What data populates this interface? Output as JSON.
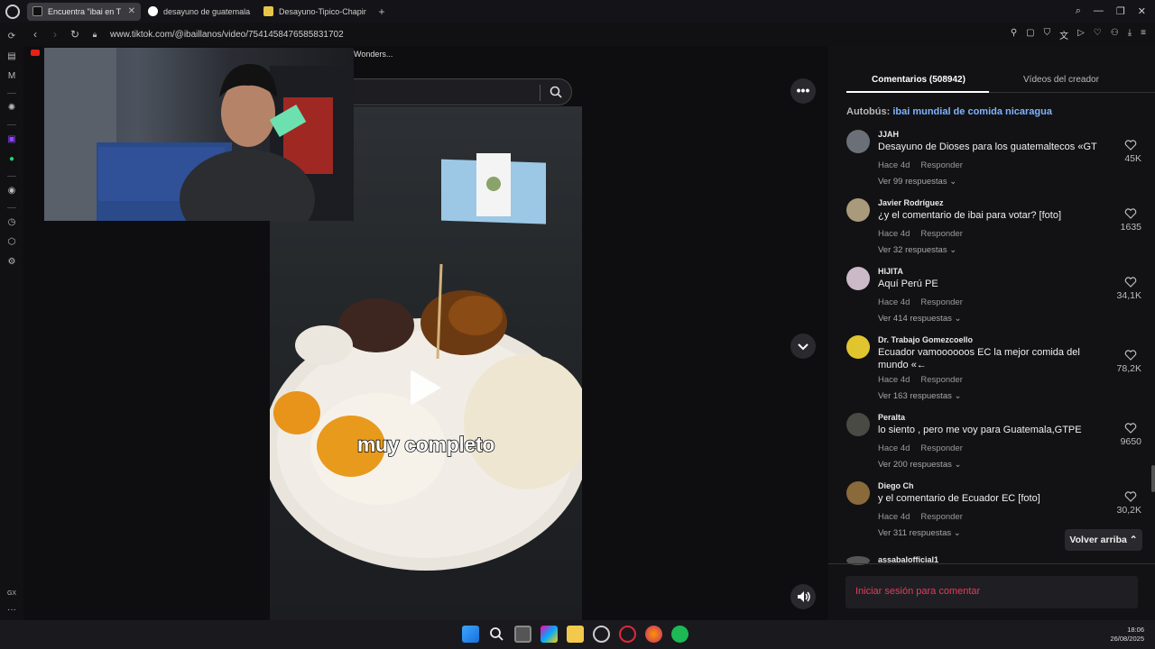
{
  "browser": {
    "tabs": [
      {
        "label": "Encuentra \"ibai en T",
        "active": true
      },
      {
        "label": "desayuno de guatemala",
        "active": false
      },
      {
        "label": "Desayuno-Tipico-Chapin",
        "active": false
      }
    ],
    "url": "www.tiktok.com/@ibaillanos/video/7541458476585831702",
    "bookmark_label": "Wonders..."
  },
  "video": {
    "caption": "muy completo"
  },
  "panel": {
    "tabs": {
      "comments": "Comentarios (508942)",
      "creator_videos": "Vídeos del creador"
    },
    "autobus": {
      "label": "Autobús:",
      "value": "ibai mundial de comida nicaragua"
    },
    "comments": [
      {
        "user": "JJAH",
        "text": "Desayuno de Dioses para los guatemaltecos «GT",
        "time": "Hace 4d",
        "reply": "Responder",
        "replies": "Ver 99 respuestas",
        "likes": "45K",
        "avatar_color": "#6b6f77"
      },
      {
        "user": "Javier Rodríguez",
        "text": "¿y el comentario de ibai para votar? [foto]",
        "time": "Hace 4d",
        "reply": "Responder",
        "replies": "Ver 32 respuestas",
        "likes": "1635",
        "avatar_color": "#a89a7a"
      },
      {
        "user": "HIJITA",
        "text": "Aquí Perú PE",
        "time": "Hace 4d",
        "reply": "Responder",
        "replies": "Ver 414 respuestas",
        "likes": "34,1K",
        "avatar_color": "#cbb9c8"
      },
      {
        "user": "Dr. Trabajo Gomezcoello",
        "text": "Ecuador vamoooooos EC la mejor comida del mundo «←",
        "time": "Hace 4d",
        "reply": "Responder",
        "replies": "Ver 163 respuestas",
        "likes": "78,2K",
        "avatar_color": "#e0c52e"
      },
      {
        "user": "Peralta",
        "text": "lo siento , pero me voy para Guatemala,GTPE",
        "time": "Hace 4d",
        "reply": "Responder",
        "replies": "Ver 200 respuestas",
        "likes": "9650",
        "avatar_color": "#4a4a44"
      },
      {
        "user": "Diego Ch",
        "text": "y el comentario de Ecuador EC [foto]",
        "time": "Hace 4d",
        "reply": "Responder",
        "replies": "Ver 311 respuestas",
        "likes": "30,2K",
        "avatar_color": "#8a6a3a"
      }
    ],
    "partial_user": "assabalofficial1",
    "back_to_top": "Volver arriba",
    "login_prompt": "Iniciar sesión para comentar"
  },
  "taskbar": {
    "time": "18:06",
    "date": "26/08/2025"
  }
}
